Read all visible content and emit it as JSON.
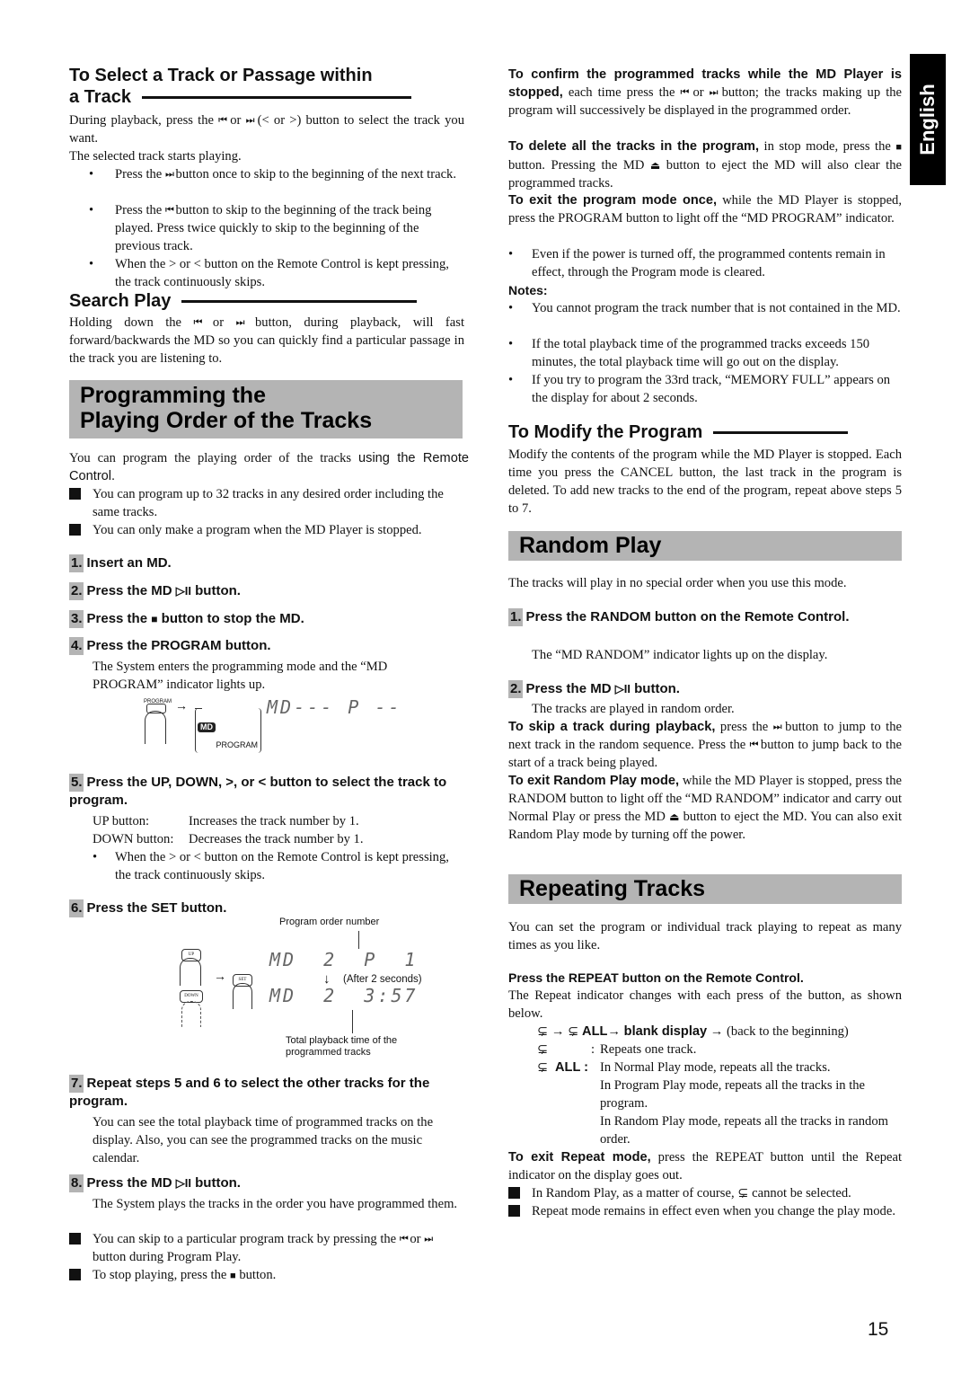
{
  "side_tab": {
    "label": "English"
  },
  "page_number": "15",
  "icons": {
    "prev": "⏮",
    "next": "⏭",
    "play_pause": "▷II",
    "stop": "■",
    "eject": "⏏",
    "repeat": "⊊",
    "arrow_right": "→",
    "arrow_down": "↓"
  },
  "select_track": {
    "heading_line1": "To Select a Track or Passage within",
    "heading_line2": "a Track",
    "intro_a": "During playback, press the",
    "intro_b": "or",
    "intro_c": "(< or >) button to select the track you want.",
    "intro2": "The selected track starts playing.",
    "bullets": [
      {
        "a": "Press the",
        "b": "button once to skip to the beginning of the next track."
      },
      {
        "a": "Press the",
        "b": "button to skip to the beginning of the track being played. Press twice quickly to skip to the beginning of the previous track."
      },
      {
        "a": "When the > or < button on the Remote Control is kept pressing, the track continuously skips.",
        "b": ""
      }
    ]
  },
  "search_play": {
    "heading": "Search Play",
    "text_a": "Holding down the",
    "text_b": "or",
    "text_c": "button, during playback, will fast forward/backwards the MD so you can quickly find a particular passage in the track you are listening to."
  },
  "programming": {
    "banner_line1": "Programming the",
    "banner_line2": "Playing Order of the Tracks",
    "intro_serif": "You can program the playing order of the tracks",
    "intro_sans": "using the Remote Control.",
    "notes": [
      "You can program up to 32 tracks in any desired order including the same tracks.",
      "You can only make a program when the MD Player is stopped."
    ],
    "steps": [
      {
        "num": "1.",
        "title": "Insert an MD."
      },
      {
        "num": "2.",
        "title_a": "Press the MD",
        "title_b": "button."
      },
      {
        "num": "3.",
        "title_a": "Press the",
        "title_b": "button to stop the MD."
      },
      {
        "num": "4.",
        "title": "Press the PROGRAM button.",
        "desc": "The System enters the programming mode and the “MD PROGRAM” indicator lights up."
      },
      {
        "num": "5.",
        "title": "Press the UP, DOWN, >, or < button to select the track to program.",
        "rows": [
          {
            "label": "UP button:",
            "value": "Increases the track number by 1."
          },
          {
            "label": "DOWN button:",
            "value": "Decreases the track number by 1."
          }
        ],
        "bullet": "When the > or < button on the Remote Control is kept pressing, the track continuously skips."
      },
      {
        "num": "6.",
        "title": "Press the SET button."
      },
      {
        "num": "7.",
        "title": "Repeat steps 5 and 6 to select the other tracks for the program.",
        "desc": "You can see the total playback time of programmed tracks on the display. Also, you can see the programmed tracks on the music calendar."
      },
      {
        "num": "8.",
        "title_a": "Press the MD",
        "title_b": "button.",
        "desc": "The System plays the tracks in the order you have programmed them."
      }
    ],
    "step4_figure": {
      "button_label": "PROGRAM",
      "indicator_md": "MD",
      "indicator_program": "PROGRAM",
      "display": "MD---  P --"
    },
    "step6_figure": {
      "callout_top": "Program order number",
      "btn_up": "UP",
      "btn_down": "DOWN",
      "btn_set": "SET",
      "display1": "MD  2  P  1",
      "after_note": "(After 2 seconds)",
      "display2": "MD  2  3:57",
      "callout_bottom_1": "Total playback time of the",
      "callout_bottom_2": "programmed tracks"
    },
    "end_notes": [
      {
        "a": "You can skip to a particular program track by pressing the",
        "b": "or",
        "c": "button during Program Play."
      },
      {
        "a": "To stop playing, press the",
        "b": "button."
      }
    ]
  },
  "confirm": {
    "lead": "To confirm the programmed tracks while the MD Player is stopped,",
    "text_a": "each time press the",
    "text_b": "or",
    "text_c": "button; the tracks making up the program will successively be displayed in the programmed order."
  },
  "delete_all": {
    "lead": "To delete all the tracks in the program,",
    "text_a": "in stop mode, press the",
    "text_b": "button. Pressing the MD",
    "text_c": "button to eject the MD will also clear the programmed tracks."
  },
  "exit_program": {
    "lead": "To exit the program mode once,",
    "text": "while the MD Player is stopped, press the PROGRAM button to light off the “MD PROGRAM” indicator.",
    "bullet": "Even if the power is turned off, the programmed contents remain in effect, through the Program mode is cleared."
  },
  "notes": {
    "label": "Notes:",
    "items": [
      "You cannot program the track number that is not contained in the MD.",
      "If the total playback time of the programmed tracks exceeds 150 minutes, the total playback time will go out on the display.",
      "If you try to program the 33rd track, “MEMORY FULL” appears on the display for about 2 seconds."
    ]
  },
  "modify": {
    "heading": "To Modify the Program",
    "text": "Modify the contents of the program while the MD Player is stopped. Each time you press the CANCEL button, the last track in the program is deleted. To add new tracks to the end of the program, repeat above steps 5 to 7."
  },
  "random": {
    "banner": "Random Play",
    "intro": "The tracks will play in no special order when you use this mode.",
    "step1_num": "1.",
    "step1_title": "Press the RANDOM button on the Remote Control.",
    "step1_desc": "The “MD RANDOM” indicator lights up on the display.",
    "step2_num": "2.",
    "step2_title_a": "Press the MD",
    "step2_title_b": "button.",
    "step2_desc": "The tracks are played in random order.",
    "skip_lead": "To skip a track during playback,",
    "skip_a": "press the",
    "skip_b": "button to jump to the next track in the random sequence. Press the",
    "skip_c": "button to jump back to the start of a track being played.",
    "exit_lead": "To exit Random Play mode,",
    "exit_a": "while the MD Player is stopped, press the RANDOM button to light off the “MD RANDOM” indicator and carry out Normal Play or press the MD",
    "exit_b": "button to eject the MD. You can also exit Random Play mode by turning off the power."
  },
  "repeat": {
    "banner": "Repeating Tracks",
    "intro": "You can set the program or individual track playing to repeat as many times as you like.",
    "instruction": "Press the REPEAT button on the Remote Control.",
    "desc": "The Repeat indicator changes with each press of the button, as shown below.",
    "sequence_all": "ALL",
    "sequence_blank": "blank display",
    "sequence_back": "(back to the beginning)",
    "one_colon": ":",
    "one_desc": "Repeats one track.",
    "all_label": "ALL :",
    "all_desc": [
      "In Normal Play mode, repeats all the tracks.",
      "In Program Play mode, repeats all the tracks in the program.",
      "In Random Play mode, repeats all the tracks in random order."
    ],
    "exit_lead": "To exit Repeat mode,",
    "exit_text": "press the REPEAT button until the Repeat indicator on the display goes out.",
    "note1_a": "In Random Play, as a matter of course,",
    "note1_b": "cannot be selected.",
    "note2": "Repeat mode remains in effect even when you change the play mode."
  }
}
